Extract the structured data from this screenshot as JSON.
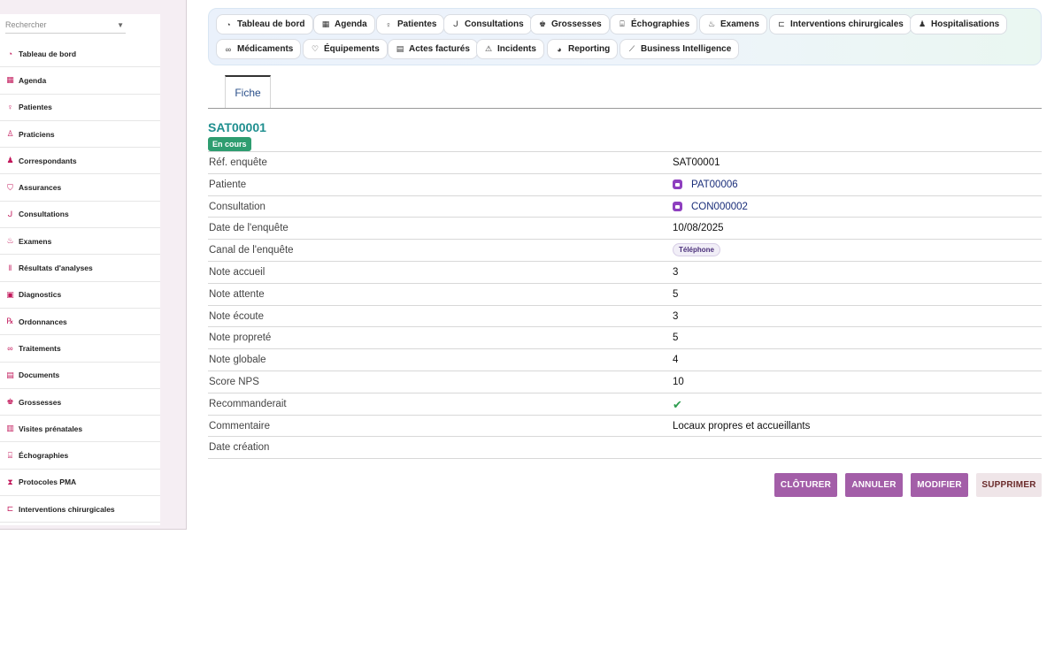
{
  "sidebar": {
    "search_placeholder": "Rechercher",
    "items": [
      {
        "label": "Tableau de bord",
        "icon": "gauge-icon"
      },
      {
        "label": "Agenda",
        "icon": "calendar-icon"
      },
      {
        "label": "Patientes",
        "icon": "female-icon"
      },
      {
        "label": "Praticiens",
        "icon": "doctor-icon"
      },
      {
        "label": "Correspondants",
        "icon": "user-icon"
      },
      {
        "label": "Assurances",
        "icon": "shield-icon"
      },
      {
        "label": "Consultations",
        "icon": "stethoscope-icon"
      },
      {
        "label": "Examens",
        "icon": "microscope-icon"
      },
      {
        "label": "Résultats d'analyses",
        "icon": "vials-icon"
      },
      {
        "label": "Diagnostics",
        "icon": "file-medical-icon"
      },
      {
        "label": "Ordonnances",
        "icon": "prescription-icon"
      },
      {
        "label": "Traitements",
        "icon": "pills-icon"
      },
      {
        "label": "Documents",
        "icon": "document-icon"
      },
      {
        "label": "Grossesses",
        "icon": "baby-icon"
      },
      {
        "label": "Visites prénatales",
        "icon": "clipboard-icon"
      },
      {
        "label": "Échographies",
        "icon": "ultrasound-icon"
      },
      {
        "label": "Protocoles PMA",
        "icon": "dna-icon"
      },
      {
        "label": "Interventions chirurgicales",
        "icon": "bed-icon"
      }
    ]
  },
  "modnav": {
    "items": [
      {
        "label": "Tableau de bord",
        "icon": "gauge-icon"
      },
      {
        "label": "Agenda",
        "icon": "calendar-icon"
      },
      {
        "label": "Patientes",
        "icon": "female-icon"
      },
      {
        "label": "Consultations",
        "icon": "stethoscope-icon"
      },
      {
        "label": "Grossesses",
        "icon": "baby-icon"
      },
      {
        "label": "Échographies",
        "icon": "ultrasound-icon"
      },
      {
        "label": "Examens",
        "icon": "microscope-icon"
      },
      {
        "label": "Interventions chirurgicales",
        "icon": "bed-icon"
      },
      {
        "label": "Hospitalisations",
        "icon": "hospital-user-icon"
      },
      {
        "label": "Médicaments",
        "icon": "pills-icon"
      },
      {
        "label": "Équipements",
        "icon": "heart-pulse-icon"
      },
      {
        "label": "Actes facturés",
        "icon": "invoice-icon"
      },
      {
        "label": "Incidents",
        "icon": "warning-icon"
      },
      {
        "label": "Reporting",
        "icon": "pie-chart-icon"
      },
      {
        "label": "Business Intelligence",
        "icon": "line-chart-icon"
      }
    ]
  },
  "tabs": [
    {
      "label": "Fiche"
    }
  ],
  "record": {
    "title": "SAT00001",
    "status": "En cours",
    "fields": [
      {
        "label": "Réf. enquête",
        "value": "SAT00001"
      },
      {
        "label": "Patiente",
        "value": "PAT00006",
        "type": "link"
      },
      {
        "label": "Consultation",
        "value": "CON000002",
        "type": "link"
      },
      {
        "label": "Date de l'enquête",
        "value": "10/08/2025"
      },
      {
        "label": "Canal de l'enquête",
        "value": "Téléphone",
        "type": "chip"
      },
      {
        "label": "Note accueil",
        "value": "3"
      },
      {
        "label": "Note attente",
        "value": "5"
      },
      {
        "label": "Note écoute",
        "value": "3"
      },
      {
        "label": "Note propreté",
        "value": "5"
      },
      {
        "label": "Note globale",
        "value": "4"
      },
      {
        "label": "Score NPS",
        "value": "10"
      },
      {
        "label": "Recommanderait",
        "value": "✔",
        "type": "check"
      },
      {
        "label": "Commentaire",
        "value": "Locaux propres et accueillants"
      },
      {
        "label": "Date création",
        "value": ""
      }
    ]
  },
  "actions": {
    "close_label": "CLÔTURER",
    "cancel_label": "ANNULER",
    "edit_label": "MODIFIER",
    "delete_label": "SUPPRIMER"
  },
  "colors": {
    "accent_teal": "#1f8f8f",
    "status_green": "#2e9d70",
    "button_purple": "#a35ea8",
    "nav_icon": "#c2185b"
  }
}
